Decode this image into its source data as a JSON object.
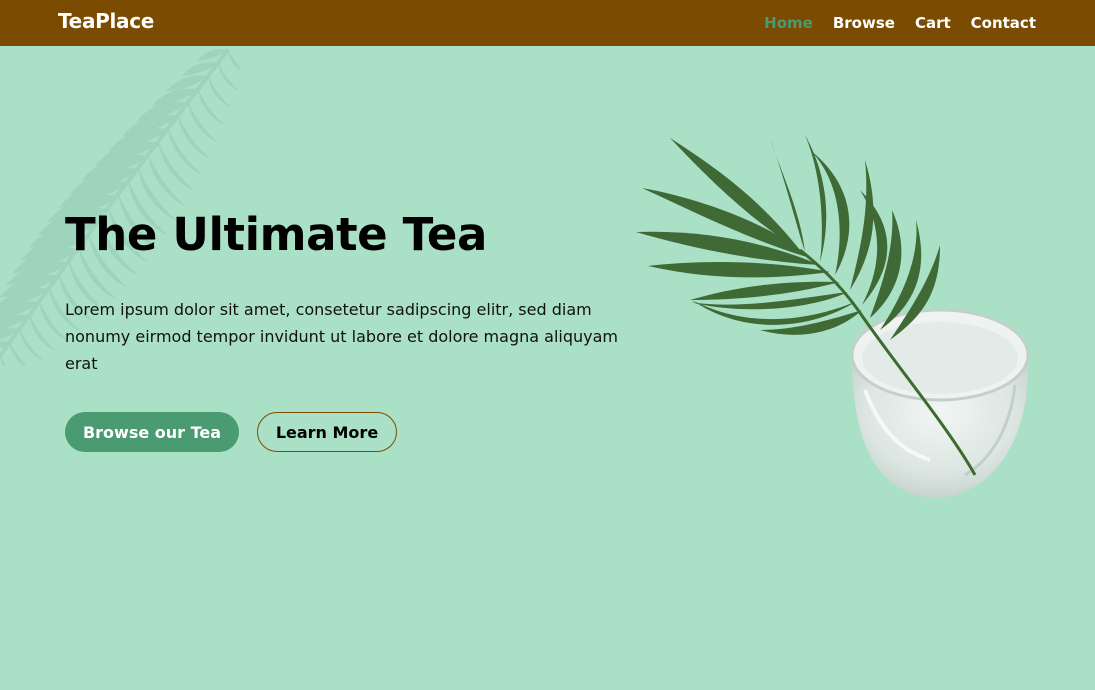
{
  "brand": "TeaPlace",
  "nav": {
    "items": [
      {
        "label": "Home",
        "active": true
      },
      {
        "label": "Browse",
        "active": false
      },
      {
        "label": "Cart",
        "active": false
      },
      {
        "label": "Contact",
        "active": false
      }
    ]
  },
  "hero": {
    "title": "The Ultimate Tea",
    "text": "Lorem ipsum dolor sit amet, consetetur sadipscing elitr, sed diam nonumy eirmod tempor invidunt ut labore et dolore magna aliquyam erat",
    "primary_button": "Browse our Tea",
    "secondary_button": "Learn More"
  },
  "icons": {
    "background_decoration": "fern-icon",
    "hero_image": "palm-leaf-in-glass-icon"
  },
  "colors": {
    "background": "#aae0c6",
    "navbar": "#7a4b00",
    "accent_green": "#4a9a72",
    "text": "#000000",
    "button_border": "#7a4b00"
  }
}
